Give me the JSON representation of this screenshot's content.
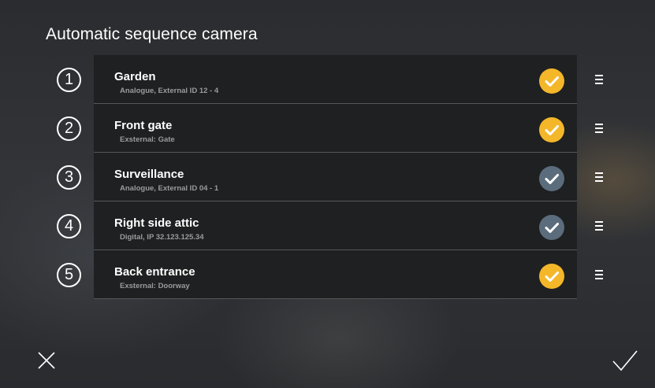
{
  "title": "Automatic sequence camera",
  "cameras": [
    {
      "number": "1",
      "name": "Garden",
      "detail": "Analogue, External ID 12 - 4",
      "selected": true
    },
    {
      "number": "2",
      "name": "Front gate",
      "detail": "Exsternal: Gate",
      "selected": true
    },
    {
      "number": "3",
      "name": "Surveillance",
      "detail": "Analogue, External ID 04 - 1",
      "selected": false
    },
    {
      "number": "4",
      "name": "Right side attic",
      "detail": "Digital, IP 32.123.125.34",
      "selected": false
    },
    {
      "number": "5",
      "name": "Back entrance",
      "detail": "Exsternal: Doorway",
      "selected": true
    }
  ],
  "colors": {
    "check_selected": "#f4b72a",
    "check_unselected": "#5b6d7c",
    "card_background": "#1f2021"
  },
  "icons": {
    "check": "check-circle-icon",
    "drag": "drag-handle-icon",
    "cancel": "close-icon",
    "confirm": "checkmark-icon"
  }
}
